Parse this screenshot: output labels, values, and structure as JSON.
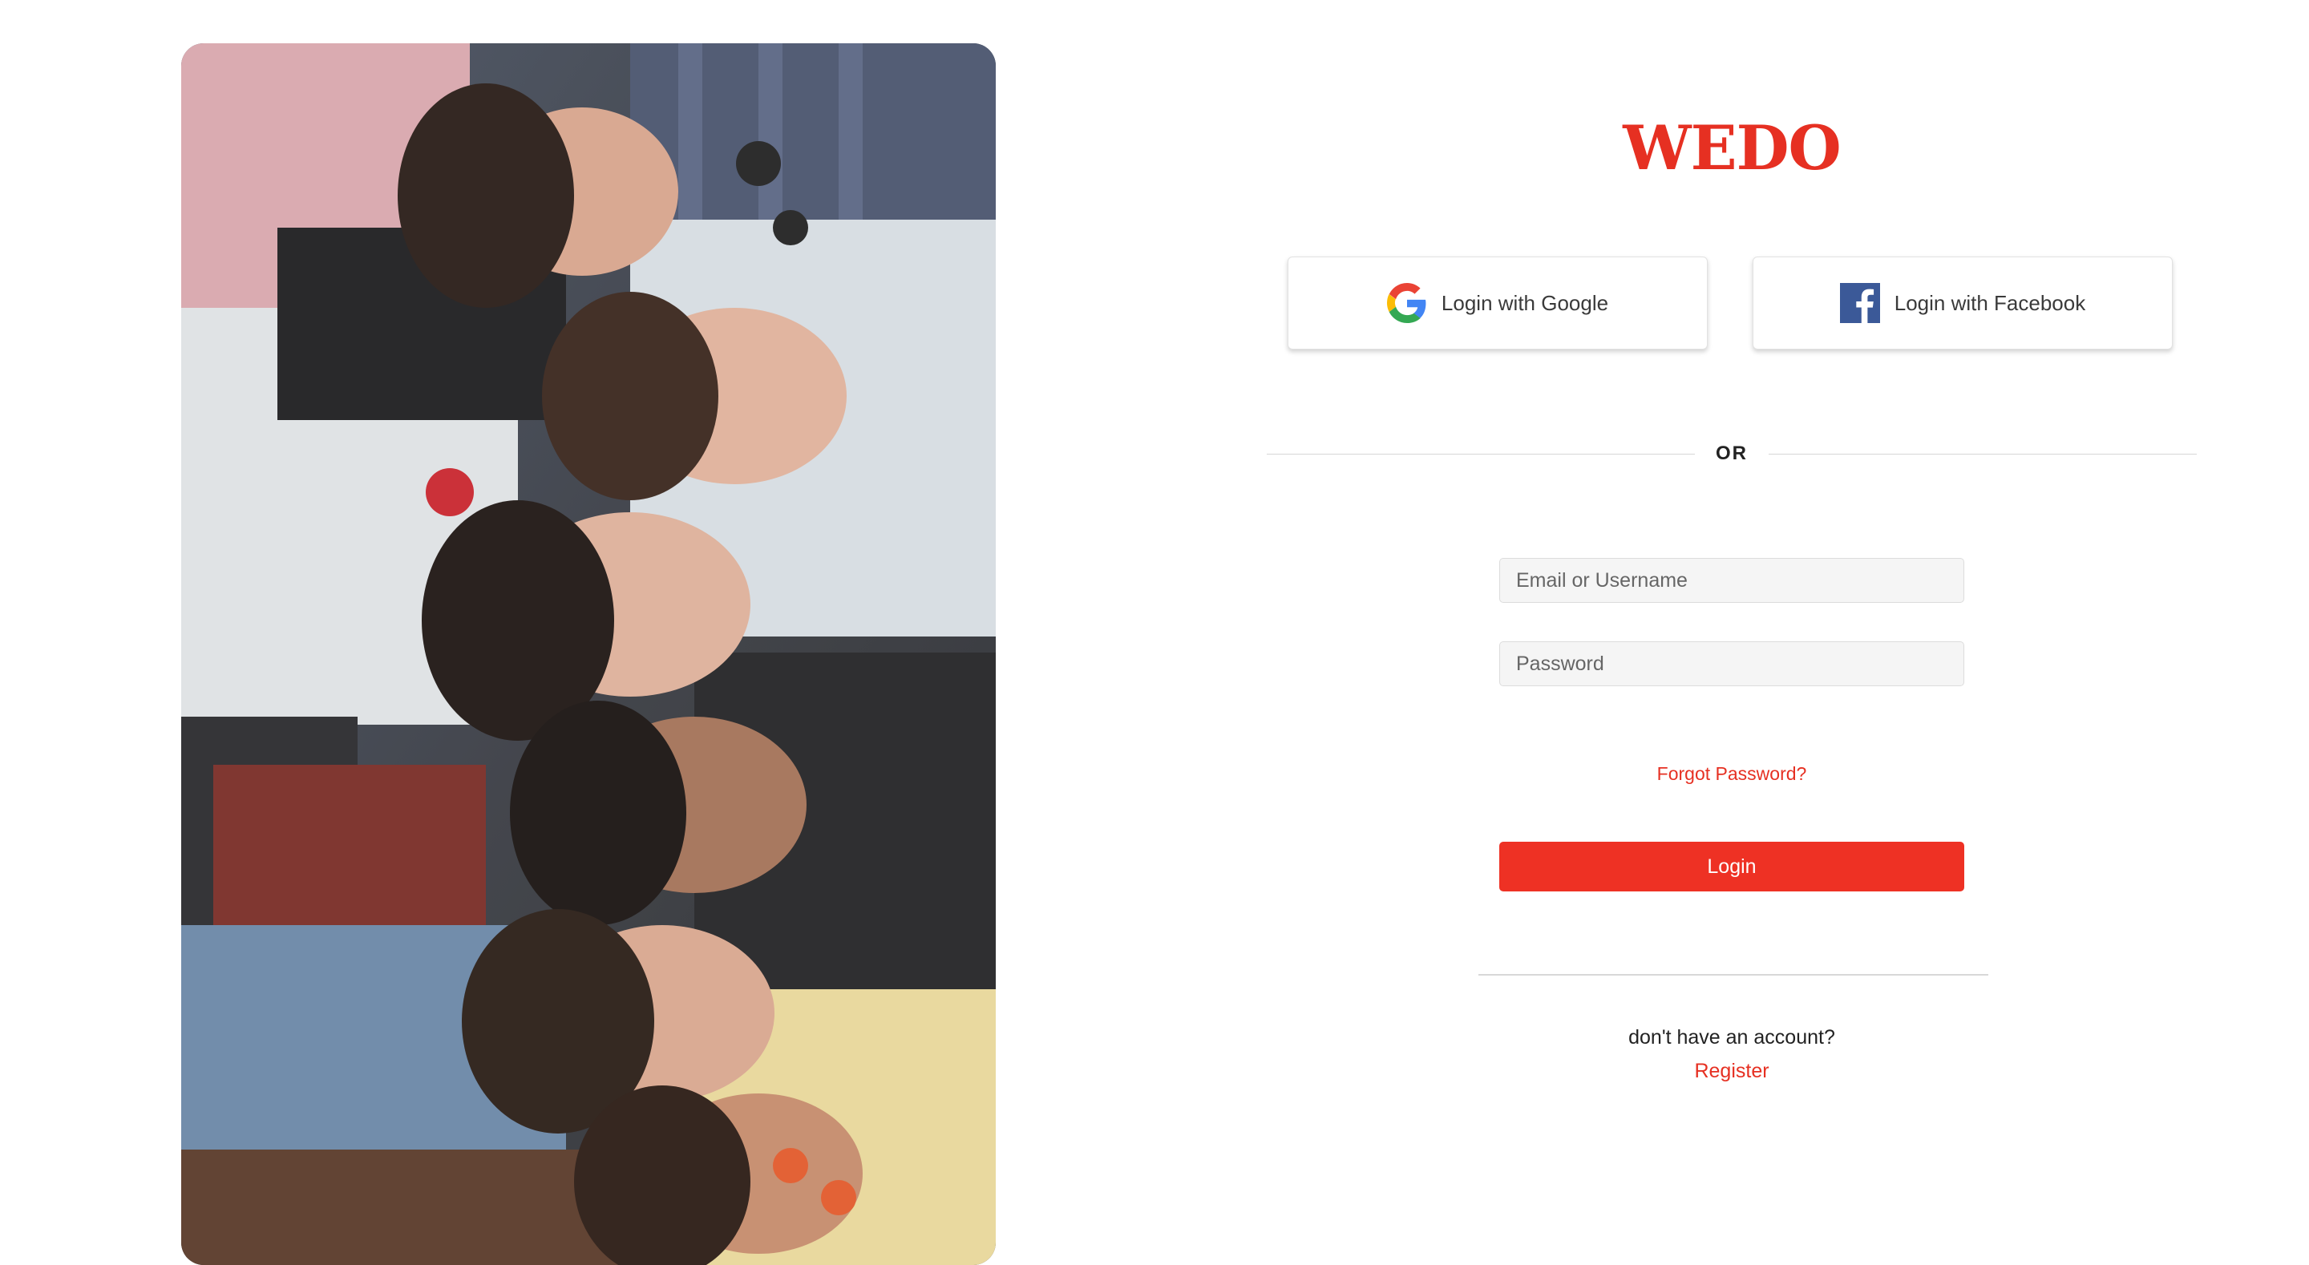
{
  "brand": {
    "name": "WEDO",
    "accent_color": "#e63022"
  },
  "hero_image": {
    "icon": "group-photo-image"
  },
  "social": {
    "google_label": "Login with Google",
    "google_icon": "google-icon",
    "facebook_label": "Login with Facebook",
    "facebook_icon": "facebook-icon"
  },
  "divider_text": "OR",
  "form": {
    "email_placeholder": "Email or Username",
    "email_value": "",
    "password_placeholder": "Password",
    "password_value": "",
    "forgot_label": "Forgot Password?",
    "login_label": "Login"
  },
  "footer": {
    "prompt": "don't have an account?",
    "register_label": "Register"
  }
}
